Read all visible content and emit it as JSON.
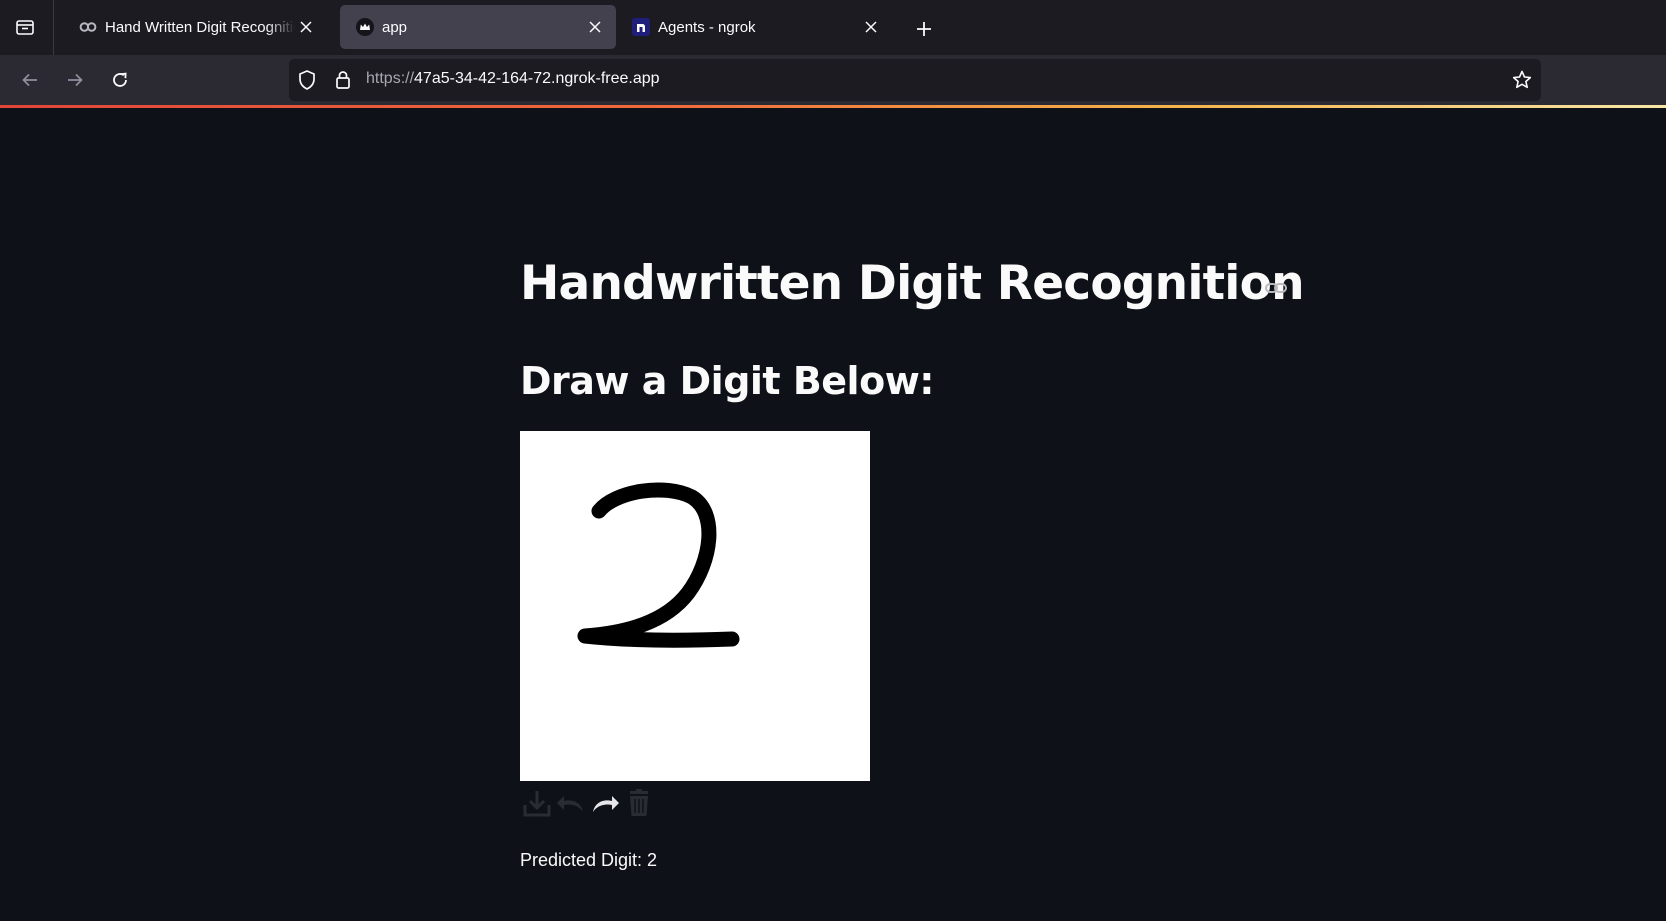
{
  "browser": {
    "tabs": [
      {
        "title": "Hand Written Digit Recognition",
        "favicon": "colab-icon",
        "active": false
      },
      {
        "title": "app",
        "favicon": "streamlit-crown-icon",
        "active": true
      },
      {
        "title": "Agents - ngrok",
        "favicon": "ngrok-icon",
        "active": false
      }
    ],
    "url": {
      "protocol": "https://",
      "host": "47a5-34-42-164-72.ngrok-free.app"
    }
  },
  "app": {
    "title": "Handwritten Digit Recognition",
    "subheader": "Draw a Digit Below:",
    "canvas": {
      "drawn_digit": "2",
      "background": "#ffffff",
      "stroke_color": "#000000"
    },
    "toolbar": [
      "download-icon",
      "undo-icon",
      "redo-icon",
      "trash-icon"
    ],
    "prediction_text": "Predicted Digit: 2"
  },
  "colors": {
    "page_bg": "#0e1117",
    "tabstrip_bg": "#1c1b22",
    "navbar_bg": "#2b2a33",
    "active_tab_bg": "#42414d",
    "text": "#fafafa"
  }
}
